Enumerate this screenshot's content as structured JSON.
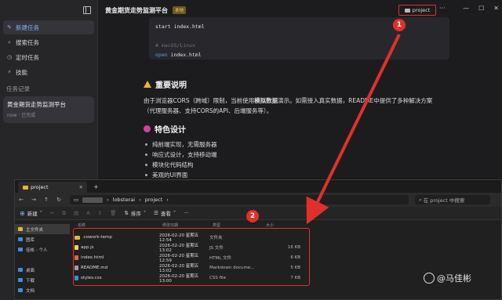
{
  "sidebar": {
    "nav": [
      {
        "icon": "✎",
        "icon_name": "new-task-icon",
        "label": "新建任务",
        "active": true
      },
      {
        "icon": "⌕",
        "icon_name": "search-icon",
        "label": "搜索任务",
        "active": false
      },
      {
        "icon": "◷",
        "icon_name": "clock-icon",
        "label": "定时任务",
        "active": false
      },
      {
        "icon": "⚡",
        "icon_name": "skill-icon",
        "label": "技能",
        "active": false
      }
    ],
    "history_title": "任务记录",
    "history": [
      {
        "name": "黄金期货走势监测平台",
        "meta": "now · 已完成"
      }
    ]
  },
  "topbar": {
    "title": "黄金期货走势监测平台",
    "badge": "本地",
    "project_button": "project",
    "more": "···",
    "minimize": "—",
    "maximize": "☐",
    "close": "✕"
  },
  "code": {
    "lines": [
      {
        "text": "start index.html",
        "kind": "plain"
      },
      {
        "text": "",
        "kind": "plain"
      },
      {
        "text": "# macOS/Linux",
        "kind": "comment"
      },
      {
        "kw": "open",
        "text": " index.html",
        "kind": "kw"
      }
    ]
  },
  "content": {
    "warning_heading": "重要说明",
    "warning_para_1a": "由于浏览器CORS（跨域）限制，当前使用",
    "warning_para_bold": "模拟数据",
    "warning_para_1b": "演示。如需接入真实数据，README中提供了多种解决方案",
    "warning_para_2": "（代理服务器、支持CORS的API、后端服务等）。",
    "features_heading": "特色设计",
    "features": [
      "纯前端实现，无需服务器",
      "响应式设计，支持移动端",
      "模块化代码结构",
      "美观的UI界面"
    ]
  },
  "explorer": {
    "tab_label": "project",
    "tab_close": "✕",
    "new_tab": "+",
    "path_segments": [
      "lobsterai",
      "project"
    ],
    "search_placeholder": "在 project 中搜索",
    "toolbar": {
      "new": "新建",
      "sort": "排序",
      "view": "查看",
      "more": "···"
    },
    "nav_items": [
      {
        "label": "主文件夹",
        "color": "#e8b339",
        "selected": true
      },
      {
        "label": "图库",
        "color": "#3b8fe0",
        "selected": false
      },
      {
        "label": "佳彬 - 个人",
        "color": "#3b8fe0",
        "selected": false
      },
      {
        "label": "",
        "color": "#202020",
        "selected": false
      },
      {
        "label": "桌面",
        "color": "#3b8fe0",
        "selected": false
      },
      {
        "label": "下载",
        "color": "#3b8fe0",
        "selected": false
      },
      {
        "label": "文档",
        "color": "#3b8fe0",
        "selected": false
      }
    ],
    "columns": {
      "name": "名称",
      "date": "修改日期",
      "type": "类型",
      "size": "大小"
    },
    "files": [
      {
        "name": ".cowork-temp",
        "date": "2026-02-20 星期五 12:54",
        "type": "文件夹",
        "size": "",
        "icon": "fold"
      },
      {
        "name": "app.js",
        "date": "2026-02-20 星期五 13:02",
        "type": "JS 文件",
        "size": "16 KB",
        "icon": "js"
      },
      {
        "name": "index.html",
        "date": "2026-02-20 星期五 12:59",
        "type": "HTML 文件",
        "size": "6 KB",
        "icon": "html"
      },
      {
        "name": "README.md",
        "date": "2026-02-20 星期五 13:02",
        "type": "Markdown docume...",
        "size": "5 KB",
        "icon": "md"
      },
      {
        "name": "styles.css",
        "date": "2026-02-20 星期五 13:00",
        "type": "CSS file",
        "size": "7 KB",
        "icon": "css"
      }
    ]
  },
  "annotations": {
    "marker_1": "1",
    "marker_2": "2",
    "color": "#e0302b"
  },
  "watermark": "@马佳彬"
}
